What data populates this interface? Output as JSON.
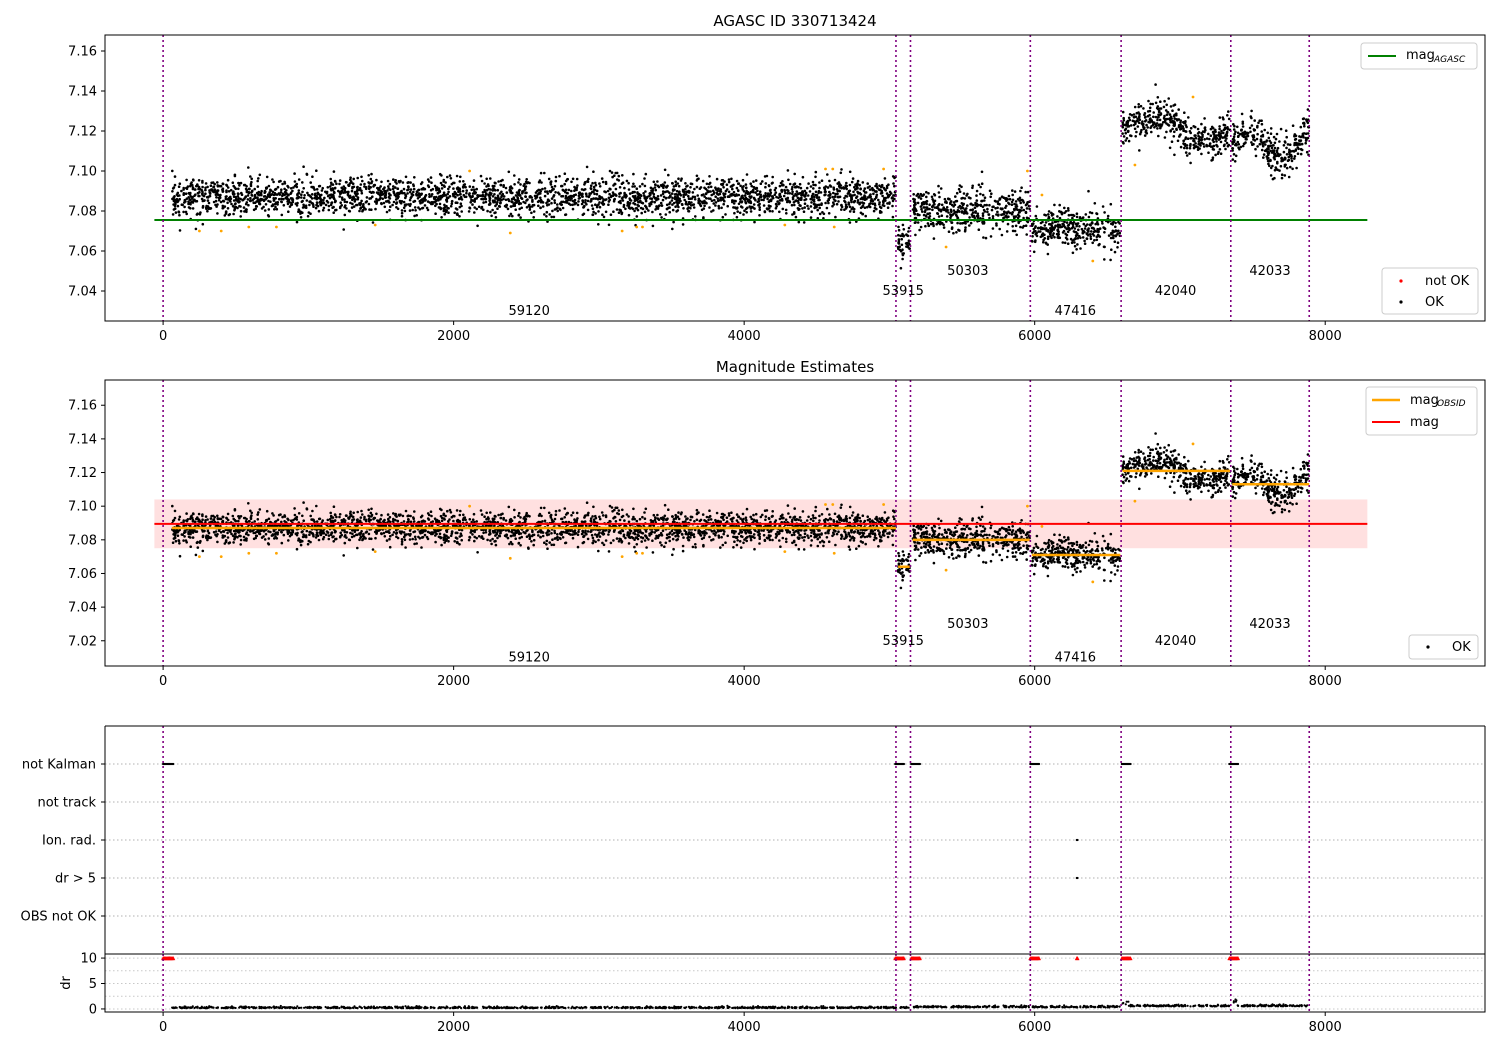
{
  "figure": {
    "colors": {
      "ok": "#000000",
      "not_ok": "#ff0000",
      "orange": "#ffa500",
      "agasc": "#008000",
      "mag_line": "#ff0000",
      "band": "#ffcccc",
      "vline": "#800080"
    },
    "vlines": [
      0,
      5045,
      5145,
      5970,
      6595,
      7350,
      7890
    ],
    "xlim": [
      -400,
      9100
    ]
  },
  "chart_data": [
    {
      "type": "scatter",
      "title": "AGASC ID 330713424",
      "xlim": [
        -400,
        9100
      ],
      "ylim": [
        7.025,
        7.168
      ],
      "xticks": [
        0,
        2000,
        4000,
        6000,
        8000
      ],
      "xtick_labels": [
        "0",
        "2000",
        "4000",
        "6000",
        "8000"
      ],
      "yticks": [
        7.04,
        7.06,
        7.08,
        7.1,
        7.12,
        7.14,
        7.16
      ],
      "ytick_labels": [
        "7.04",
        "7.06",
        "7.08",
        "7.10",
        "7.12",
        "7.14",
        "7.16"
      ],
      "mag_agasc": 7.0755,
      "mag_agasc_xrange": [
        -60,
        8290
      ],
      "legend_top": {
        "label": "mag",
        "sub": "AGASC"
      },
      "legend_bottom": [
        {
          "label": "not OK"
        },
        {
          "label": "OK"
        }
      ],
      "segments": [
        {
          "obsid": "59120",
          "x0": 60,
          "x1": 5045,
          "mean": 7.087,
          "sd": 0.0048,
          "label_x": 2520,
          "label_y": 7.03
        },
        {
          "obsid": "53915",
          "x0": 5060,
          "x1": 5140,
          "mean": 7.064,
          "sd": 0.0045,
          "label_x": 5095,
          "label_y": 7.04
        },
        {
          "obsid": "50303",
          "x0": 5160,
          "x1": 5965,
          "mean": 7.08,
          "sd": 0.0055,
          "label_x": 5540,
          "label_y": 7.05
        },
        {
          "obsid": "47416",
          "x0": 5980,
          "x1": 6590,
          "mean": 7.071,
          "sd": 0.005,
          "label_x": 6280,
          "label_y": 7.03
        },
        {
          "obsid": "42040",
          "x0": 6605,
          "x1": 7345,
          "mean": 7.121,
          "sd": 0.005,
          "label_x": 6970,
          "label_y": 7.04
        },
        {
          "obsid": "42033",
          "x0": 7360,
          "x1": 7890,
          "mean": 7.113,
          "sd": 0.005,
          "label_x": 7620,
          "label_y": 7.05
        }
      ],
      "outliers": [
        [
          250,
          7.07
        ],
        [
          400,
          7.07
        ],
        [
          590,
          7.072
        ],
        [
          780,
          7.072
        ],
        [
          1460,
          7.073
        ],
        [
          2110,
          7.1
        ],
        [
          2390,
          7.069
        ],
        [
          3160,
          7.07
        ],
        [
          3260,
          7.072
        ],
        [
          3300,
          7.072
        ],
        [
          4280,
          7.073
        ],
        [
          4560,
          7.101
        ],
        [
          4610,
          7.101
        ],
        [
          4620,
          7.072
        ],
        [
          4960,
          7.101
        ],
        [
          5390,
          7.062
        ],
        [
          5950,
          7.1
        ],
        [
          6050,
          7.088
        ],
        [
          6400,
          7.055
        ],
        [
          6690,
          7.103
        ],
        [
          7090,
          7.137
        ]
      ]
    },
    {
      "type": "scatter",
      "title": "Magnitude Estimates",
      "xlim": [
        -400,
        9100
      ],
      "ylim": [
        7.005,
        7.175
      ],
      "xticks": [
        0,
        2000,
        4000,
        6000,
        8000
      ],
      "xtick_labels": [
        "0",
        "2000",
        "4000",
        "6000",
        "8000"
      ],
      "yticks": [
        7.02,
        7.04,
        7.06,
        7.08,
        7.1,
        7.12,
        7.14,
        7.16
      ],
      "ytick_labels": [
        "7.02",
        "7.04",
        "7.06",
        "7.08",
        "7.10",
        "7.12",
        "7.14",
        "7.16"
      ],
      "mag": 7.0895,
      "mag_band": [
        7.075,
        7.104
      ],
      "mag_xrange": [
        -60,
        8290
      ],
      "legend_top": [
        {
          "label": "mag",
          "sub": "OBSID"
        },
        {
          "label": "mag"
        }
      ],
      "legend_bottom": [
        {
          "label": "OK"
        }
      ],
      "label_offset": -0.02
    },
    {
      "type": "scatter",
      "categories": [
        "not Kalman",
        "not track",
        "Ion. rad.",
        "dr > 5",
        "OBS not OK"
      ],
      "flag_ranges": {
        "not Kalman": [
          [
            0,
            70
          ],
          [
            5040,
            5100
          ],
          [
            5150,
            5210
          ],
          [
            5970,
            6030
          ],
          [
            6600,
            6660
          ],
          [
            7340,
            7400
          ]
        ],
        "Ion. rad.": [
          [
            6290,
            6295
          ]
        ],
        "dr > 5": [
          [
            6290,
            6295
          ]
        ]
      }
    },
    {
      "type": "scatter",
      "ylabel": "dr",
      "xlim": [
        -400,
        9100
      ],
      "ylim": [
        -0.6,
        10.8
      ],
      "yticks": [
        0,
        5,
        10
      ],
      "ytick_labels": [
        "0",
        "5",
        "10"
      ],
      "xticks": [
        0,
        2000,
        4000,
        6000,
        8000
      ],
      "xtick_labels": [
        "0",
        "2000",
        "4000",
        "6000",
        "8000"
      ],
      "red_ranges": [
        [
          0,
          70
        ],
        [
          5040,
          5100
        ],
        [
          5150,
          5210
        ],
        [
          5970,
          6030
        ],
        [
          6600,
          6660
        ],
        [
          7340,
          7400
        ],
        [
          6290,
          6295
        ]
      ],
      "dr_segments": [
        {
          "x0": 60,
          "x1": 5045,
          "level": 0.15
        },
        {
          "x0": 5060,
          "x1": 5140,
          "level": 0.2
        },
        {
          "x0": 5160,
          "x1": 5965,
          "level": 0.3
        },
        {
          "x0": 5980,
          "x1": 6590,
          "level": 0.3
        },
        {
          "x0": 6605,
          "x1": 7345,
          "level": 0.5
        },
        {
          "x0": 7360,
          "x1": 7890,
          "level": 0.5
        }
      ]
    }
  ]
}
